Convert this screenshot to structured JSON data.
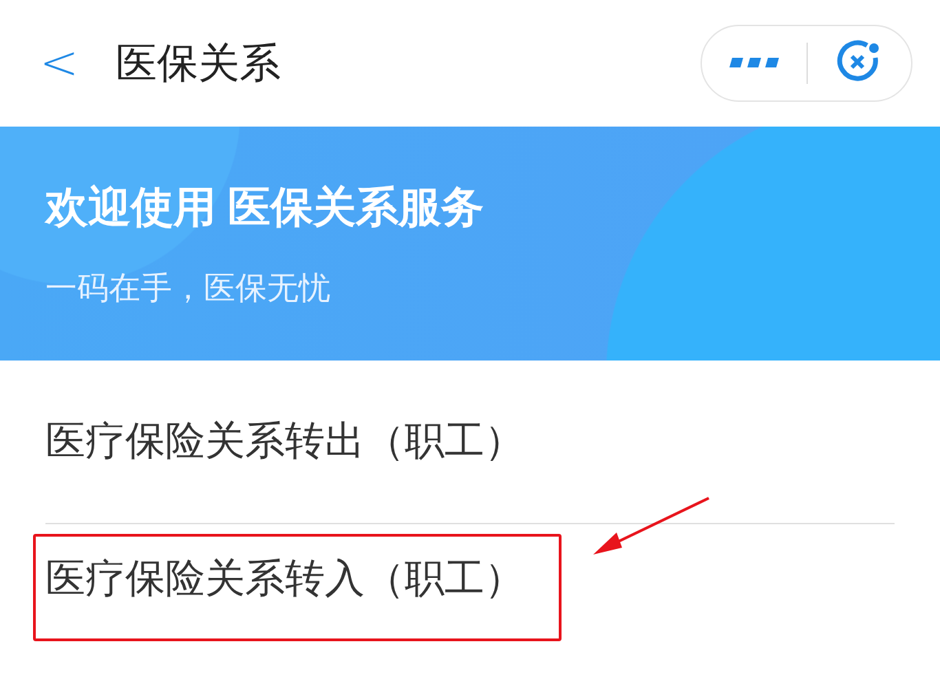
{
  "header": {
    "back": "<",
    "title": "医保关系"
  },
  "banner": {
    "title": "欢迎使用 医保关系服务",
    "subtitle": "一码在手，医保无忧"
  },
  "items": [
    {
      "label": "医疗保险关系转出（职工）",
      "highlighted": false
    },
    {
      "label": "医疗保险关系转入（职工）",
      "highlighted": true
    }
  ]
}
